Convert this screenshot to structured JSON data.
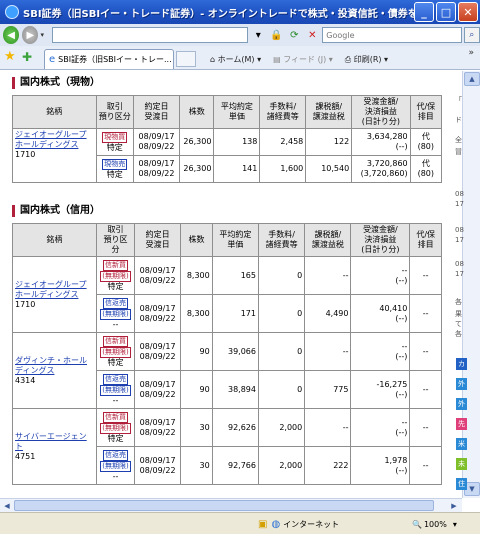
{
  "window": {
    "title": "SBI証券（旧SBIイー・トレード証券）- オンライントレードで株式・投資信託・債券を - - Win...",
    "min_label": "_",
    "max_label": "□",
    "close_label": "✕"
  },
  "address": {
    "search_placeholder": "Google"
  },
  "tabs": {
    "active_tab": "SBI証券（旧SBIイー・トレー...",
    "home": "ホーム(M)",
    "feed": "フィード (J)",
    "print": "印刷(R)"
  },
  "spot": {
    "title": "国内株式（現物）",
    "headers": [
      "銘柄",
      "取引\n預り区分",
      "約定日\n受渡日",
      "株数",
      "平均約定\n単価",
      "手数料/\n諸経費等",
      "課税額/\n譲渡益税",
      "受渡金額/\n決済損益\n(日計り分)",
      "代/保\n排目"
    ],
    "name": "ジェイオーグループホールディングス",
    "code": "1710",
    "rows": [
      {
        "tag": "現物買",
        "acct": "特定",
        "d1": "08/09/17",
        "d2": "08/09/22",
        "qty": "26,300",
        "price": "138",
        "fee": "2,458",
        "tax": "122",
        "amt": "3,634,280",
        "amt2": "(--)",
        "dai": "代",
        "dai2": "(80)"
      },
      {
        "tag": "現物売",
        "acct": "特定",
        "d1": "08/09/17",
        "d2": "08/09/22",
        "qty": "26,300",
        "price": "141",
        "fee": "1,600",
        "tax": "10,540",
        "amt": "3,720,860",
        "amt2": "(3,720,860)",
        "dai": "代",
        "dai2": "(80)"
      }
    ]
  },
  "margin": {
    "title": "国内株式（信用）",
    "headers": [
      "銘柄",
      "取引\n預り区\n分",
      "約定日\n受渡日",
      "株数",
      "平均約定\n単価",
      "手数料/\n諸経費等",
      "課税額/\n譲渡益税",
      "受渡金額/\n決済損益\n(日計り分)",
      "代/保\n排目"
    ],
    "stocks": [
      {
        "name": "ジェイオーグループホールディングス",
        "code": "1710",
        "rows": [
          {
            "tag1": "信新買",
            "tag2": "(無期限)",
            "acct": "特定",
            "d1": "08/09/17",
            "d2": "08/09/22",
            "qty": "8,300",
            "price": "165",
            "fee": "0",
            "tax": "--",
            "amt": "--",
            "amt2": "(--)",
            "dai": "--"
          },
          {
            "tag1": "信返売",
            "tag2": "(無期限)",
            "acct": "--",
            "d1": "08/09/17",
            "d2": "08/09/22",
            "qty": "8,300",
            "price": "171",
            "fee": "0",
            "tax": "4,490",
            "amt": "40,410",
            "amt2": "(--)",
            "dai": "--"
          }
        ]
      },
      {
        "name": "ダヴィンチ・ホールディングス",
        "code": "4314",
        "rows": [
          {
            "tag1": "信新買",
            "tag2": "(無期限)",
            "acct": "特定",
            "d1": "08/09/17",
            "d2": "08/09/22",
            "qty": "90",
            "price": "39,066",
            "fee": "0",
            "tax": "--",
            "amt": "--",
            "amt2": "(--)",
            "dai": "--"
          },
          {
            "tag1": "信返売",
            "tag2": "(無期限)",
            "acct": "--",
            "d1": "08/09/17",
            "d2": "08/09/22",
            "qty": "90",
            "price": "38,894",
            "fee": "0",
            "tax": "775",
            "amt": "-16,275",
            "amt2": "(--)",
            "dai": "--"
          }
        ]
      },
      {
        "name": "サイバーエージェント",
        "code": "4751",
        "rows": [
          {
            "tag1": "信新買",
            "tag2": "(無期限)",
            "acct": "特定",
            "d1": "08/09/17",
            "d2": "08/09/22",
            "qty": "30",
            "price": "92,626",
            "fee": "2,000",
            "tax": "--",
            "amt": "--",
            "amt2": "(--)",
            "dai": "--"
          },
          {
            "tag1": "信返売",
            "tag2": "(無期限)",
            "acct": "--",
            "d1": "08/09/17",
            "d2": "08/09/22",
            "qty": "30",
            "price": "92,766",
            "fee": "2,000",
            "tax": "222",
            "amt": "1,978",
            "amt2": "(--)",
            "dai": "--"
          }
        ]
      }
    ]
  },
  "right_pane": {
    "texts": [
      "「",
      "ド",
      "全",
      "冒",
      "08",
      "17",
      "08",
      "17",
      "08",
      "17",
      "各",
      "果",
      "て",
      "各"
    ],
    "badges": [
      {
        "label": "カ",
        "color": "#2160c4"
      },
      {
        "label": "外",
        "color": "#2a8ad6"
      },
      {
        "label": "外",
        "color": "#2a8ad6"
      },
      {
        "label": "先",
        "color": "#e0407a"
      },
      {
        "label": "米",
        "color": "#2a8ad6"
      },
      {
        "label": "未",
        "color": "#7fbf2a"
      },
      {
        "label": "住",
        "color": "#2a8ad6"
      }
    ]
  },
  "status": {
    "zone": "インターネット",
    "zoom": "100%"
  }
}
